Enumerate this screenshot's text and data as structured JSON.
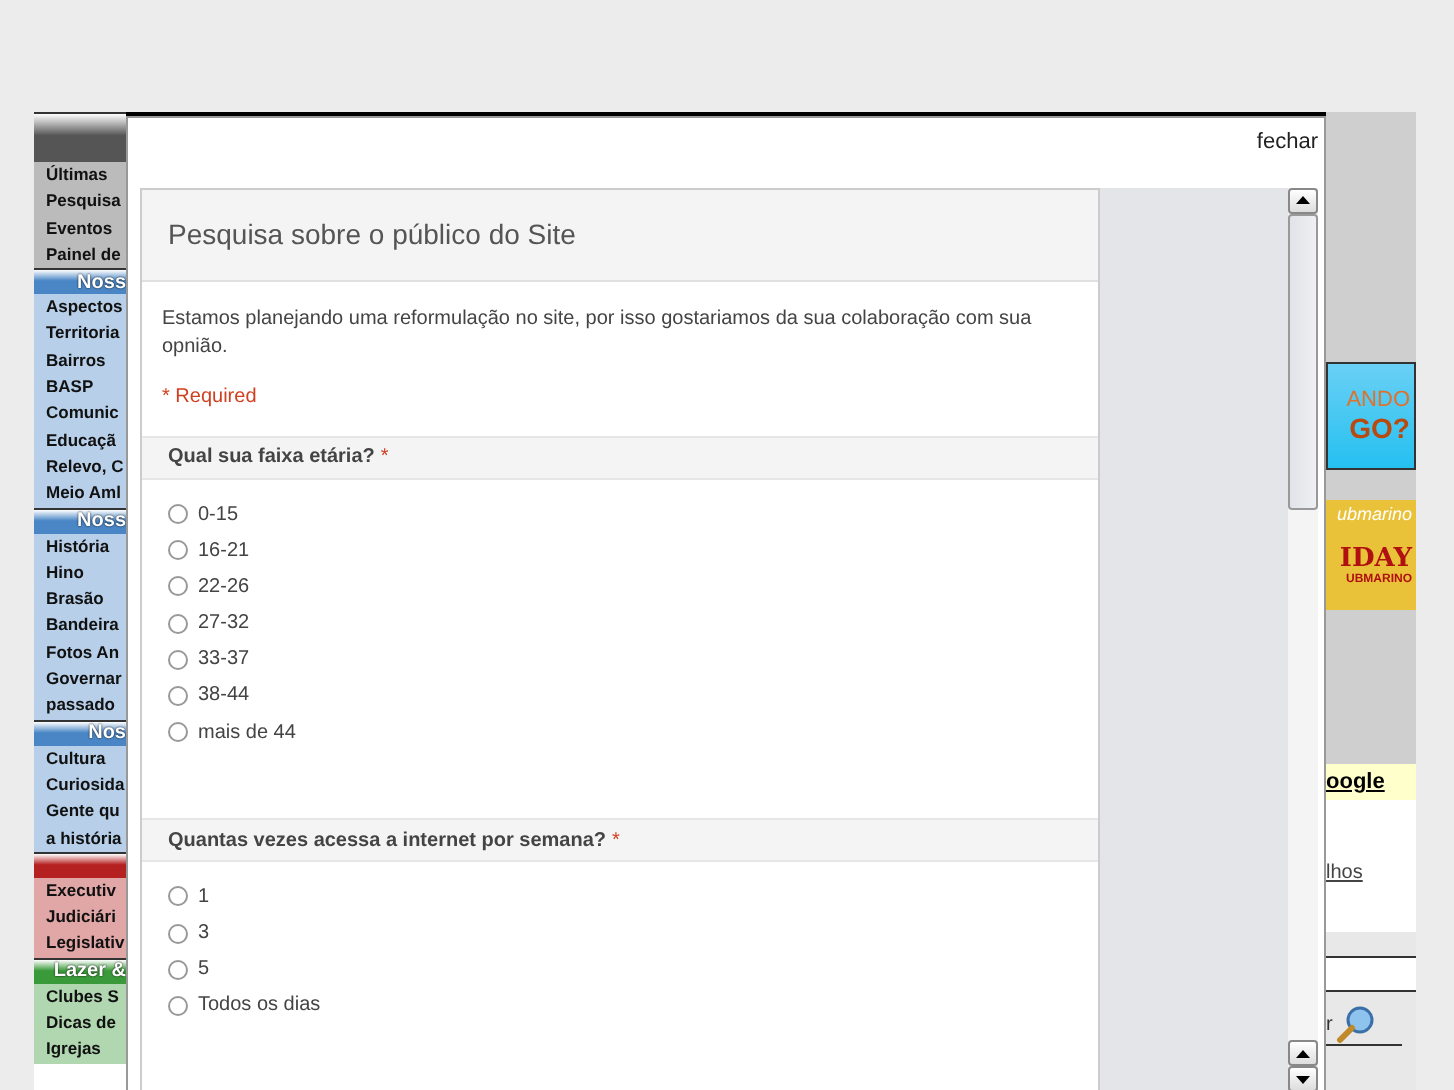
{
  "site": {
    "sidebar": [
      {
        "kind": "header",
        "color": "#555555",
        "items": [
          "Últimas",
          "Pesquisa",
          "Eventos",
          "Painel de"
        ]
      },
      {
        "kind": "header",
        "color": "#4a86c5",
        "label": "Noss",
        "items": [
          "Aspectos",
          "Territoria",
          "Bairros",
          "BASP",
          "Comunic",
          "Educaçã",
          "Relevo, C",
          "Meio Aml"
        ]
      },
      {
        "kind": "header",
        "color": "#4a86c5",
        "label": "Noss",
        "items": [
          "História",
          "Hino",
          "Brasão",
          "Bandeira",
          "Fotos An",
          "Governar",
          "passado"
        ]
      },
      {
        "kind": "header",
        "color": "#4a86c5",
        "label": "Nos",
        "items": [
          "Cultura",
          "Curiosida",
          "Gente qu",
          "a história"
        ]
      },
      {
        "kind": "header",
        "color": "#b52020",
        "items": [
          "Executiv",
          "Judiciári",
          "Legislativ"
        ]
      },
      {
        "kind": "header",
        "color": "#3a9a3a",
        "label": "Lazer &",
        "items": [
          "Clubes S",
          "Dicas de",
          "Igrejas"
        ]
      }
    ],
    "ads": [
      {
        "line1": "ANDO",
        "line2": "GO?"
      },
      {
        "line1": "ubmarino",
        "line2": "IDAY",
        "line3": "UBMARINO"
      }
    ],
    "google_link": "oogle",
    "link": "lhos",
    "search_label": "r"
  },
  "modal": {
    "close": "fechar",
    "form": {
      "title": "Pesquisa sobre o público do Site",
      "description": "Estamos planejando uma reformulação no site, por isso gostariamos da sua colaboração com sua opnião.",
      "required_note": "* Required",
      "questions": [
        {
          "label": "Qual sua faixa etária?",
          "required_mark": "*",
          "options": [
            {
              "label": "0-15",
              "selected": false
            },
            {
              "label": "16-21",
              "selected": false
            },
            {
              "label": "22-26",
              "selected": false
            },
            {
              "label": "27-32",
              "selected": false
            },
            {
              "label": "33-37",
              "selected": false
            },
            {
              "label": "38-44",
              "selected": false
            },
            {
              "label": "mais de 44",
              "selected": false
            }
          ]
        },
        {
          "label": "Quantas vezes acessa a internet por semana?",
          "required_mark": "*",
          "options": [
            {
              "label": "1",
              "selected": false
            },
            {
              "label": "3",
              "selected": false
            },
            {
              "label": "5",
              "selected": false
            },
            {
              "label": "Todos os dias",
              "selected": false
            }
          ]
        }
      ]
    }
  }
}
